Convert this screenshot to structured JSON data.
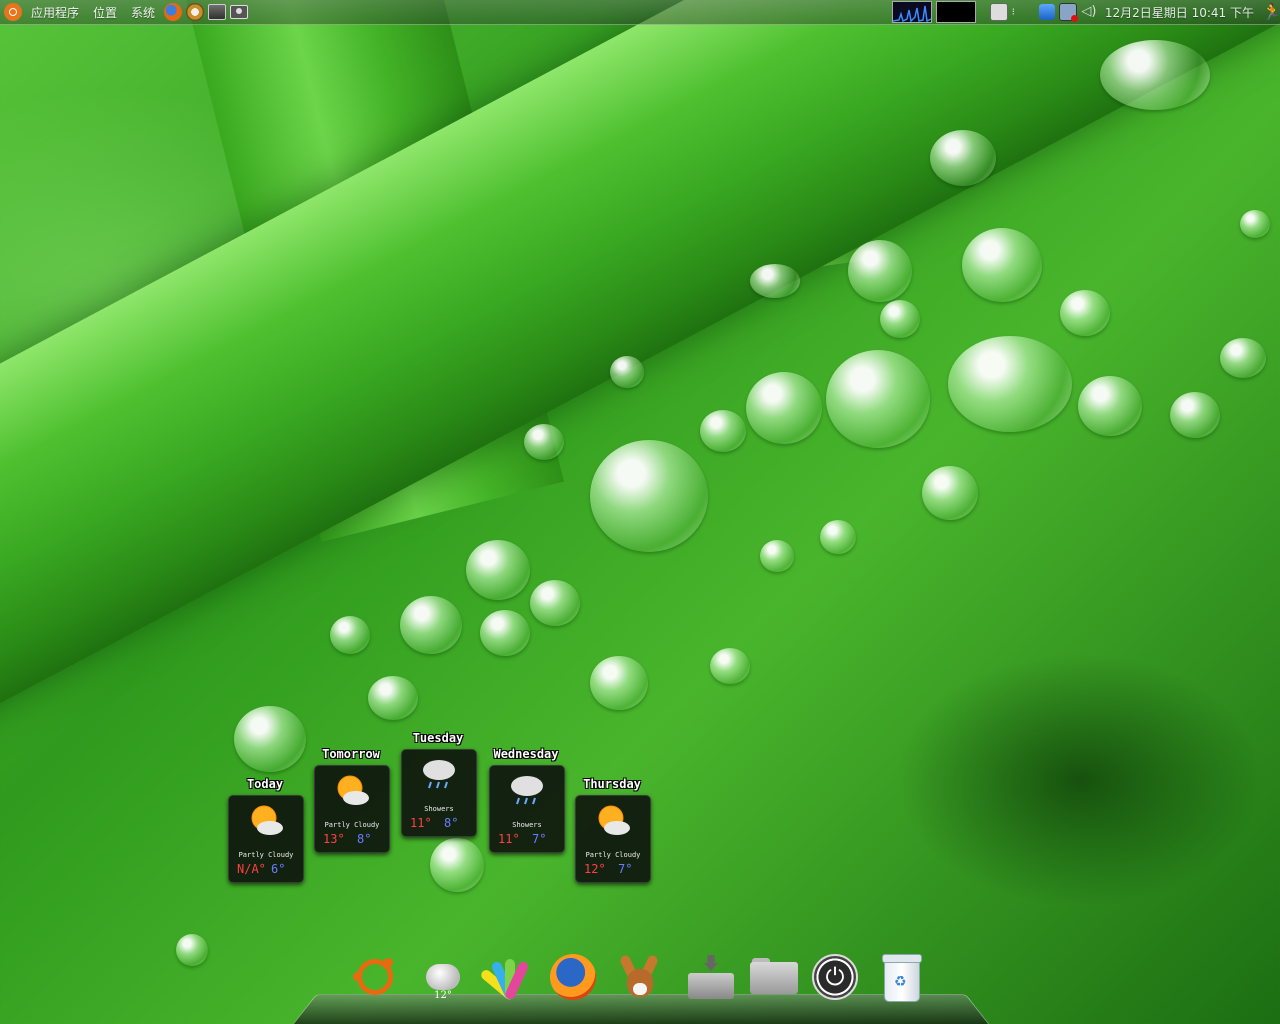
{
  "panel": {
    "menus": [
      "应用程序",
      "位置",
      "系统"
    ],
    "clock": "12月2日星期日 10:41 下午",
    "launchers": [
      "firefox-icon",
      "gnome-settings-icon",
      "terminal-icon",
      "screenshot-icon"
    ],
    "tray": [
      "system-monitor-icon",
      "notes-icon",
      "network-icon",
      "network-monitor-icon",
      "volume-icon",
      "quit-icon"
    ]
  },
  "weather": {
    "days": [
      {
        "day": "Today",
        "condition": "Partly Cloudy",
        "high": "N/A°",
        "low": "6°",
        "icon": "partly-cloudy-icon"
      },
      {
        "day": "Tomorrow",
        "condition": "Partly Cloudy",
        "high": "13°",
        "low": "8°",
        "icon": "partly-cloudy-icon"
      },
      {
        "day": "Tuesday",
        "condition": "Showers",
        "high": "11°",
        "low": "8°",
        "icon": "showers-icon"
      },
      {
        "day": "Wednesday",
        "condition": "Showers",
        "high": "11°",
        "low": "7°",
        "icon": "showers-icon"
      },
      {
        "day": "Thursday",
        "condition": "Partly Cloudy",
        "high": "12°",
        "low": "7°",
        "icon": "partly-cloudy-icon"
      }
    ]
  },
  "dock": {
    "items": [
      "ubuntu-icon",
      "weather-icon",
      "palette-icon",
      "firefox-icon",
      "emule-icon",
      "download-icon",
      "folder-icon",
      "power-icon",
      "trash-icon"
    ],
    "weather_temp": "12°"
  },
  "colors": {
    "high_temp": "#ff4040",
    "low_temp": "#6b7bff",
    "accent": "#e86a10"
  }
}
